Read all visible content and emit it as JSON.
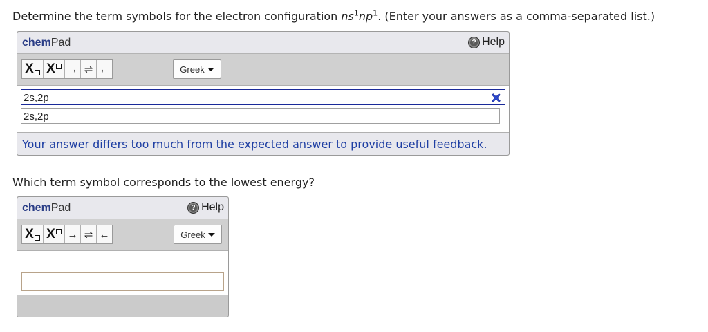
{
  "question1": {
    "lead": "Determine the term symbols for the electron configuration ",
    "config_s": "ns",
    "config_s_sup": "1",
    "config_p": "np",
    "config_p_sup": "1",
    "tail": ". (Enter your answers as a comma-separated list.)"
  },
  "pad": {
    "brand_bold": "chem",
    "brand_rest": "Pad",
    "help_label": "Help",
    "greek_label": "Greek",
    "tool_sub_label": "X",
    "tool_sup_label": "X",
    "arrow_right": "→",
    "arrow_equilibrium": "⇌",
    "arrow_left": "←"
  },
  "answer1": {
    "value": "2s,2p",
    "rendered": "2s,2p",
    "feedback": "Your answer differs too much from the expected answer to provide useful feedback."
  },
  "question2": {
    "text": "Which term symbol corresponds to the lowest energy?"
  },
  "answer2": {
    "value": "",
    "rendered": ""
  },
  "colors": {
    "brand": "#2a3d86",
    "feedback": "#1f3fa3",
    "incorrect": "#2e4bd0",
    "pad_bg": "#cbcbcb"
  },
  "icons": {
    "help": "help-circle-icon",
    "incorrect": "x-mark-icon",
    "dropdown": "caret-down-icon"
  }
}
